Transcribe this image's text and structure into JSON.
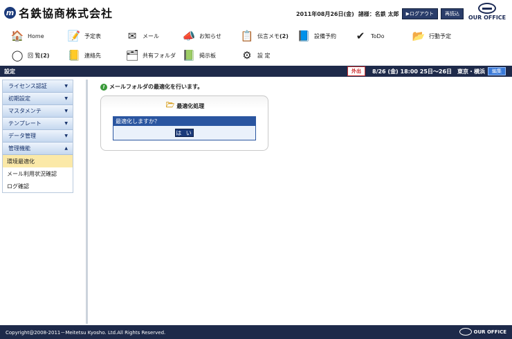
{
  "header": {
    "company": "名鉄協商株式会社",
    "logo_glyph": "m",
    "date": "2011年08月26日(金)",
    "user_label": "諸様：名鉄 太郎",
    "logout_label": "▶ログアウト",
    "reload_label": "再読込",
    "brand_text": "OUR OFFICE"
  },
  "nav": {
    "items": [
      {
        "label": "Home",
        "icon": "house-icon",
        "glyph": "🏠"
      },
      {
        "label": "予定表",
        "icon": "schedule-icon",
        "glyph": "📝"
      },
      {
        "label": "メール",
        "icon": "mail-icon",
        "glyph": "✉"
      },
      {
        "label": "お知らせ",
        "icon": "megaphone-icon",
        "glyph": "📣"
      },
      {
        "label": "伝言メモ",
        "count": "(2)",
        "icon": "memo-icon",
        "glyph": "📋"
      },
      {
        "label": "設備予約",
        "icon": "facility-icon",
        "glyph": "📘"
      },
      {
        "label": "ToDo",
        "icon": "todo-icon",
        "glyph": "✔"
      },
      {
        "label": "行動予定",
        "icon": "plan-icon",
        "glyph": "📂"
      },
      {
        "label": "回 覧",
        "count": "(2)",
        "icon": "circular-icon",
        "glyph": "◯"
      },
      {
        "label": "連絡先",
        "icon": "contacts-icon",
        "glyph": "📒"
      },
      {
        "label": "共有フォルダ",
        "icon": "shared-folder-icon",
        "glyph": "🗂"
      },
      {
        "label": "掲示板",
        "icon": "board-icon",
        "glyph": "📗"
      },
      {
        "label": "設 定",
        "icon": "settings-icon",
        "glyph": "⚙"
      }
    ]
  },
  "titlebar": {
    "title": "設定",
    "status_badge": "外出",
    "schedule": "8/26 (金) 18:00 25日～26日　東京・横浜",
    "edit_label": "編集"
  },
  "sidebar": {
    "sections": [
      {
        "label": "ライセンス認証",
        "arrow": "▼"
      },
      {
        "label": "初期設定",
        "arrow": "▼"
      },
      {
        "label": "マスタメンテ",
        "arrow": "▼"
      },
      {
        "label": "テンプレート",
        "arrow": "▼"
      },
      {
        "label": "データ管理",
        "arrow": "▼"
      },
      {
        "label": "管理機能",
        "arrow": "▲"
      }
    ],
    "subitems": [
      {
        "label": "環境最適化",
        "active": true
      },
      {
        "label": "メール利用状況確認",
        "active": false
      },
      {
        "label": "ログ確認",
        "active": false
      }
    ]
  },
  "main": {
    "message": "メールフォルダの最適化を行います。",
    "info_glyph": "!",
    "panel_title": "最適化処理",
    "confirm_question": "最適化しますか？",
    "yes_label": "は い"
  },
  "footer": {
    "copyright": "Copyright@2008-2011－Meitetsu Kyosho. Ltd.All Rights Reserved.",
    "brand_text": "OUR OFFICE"
  },
  "colors": {
    "navy": "#1e2a4a",
    "accent_blue": "#2a55a0",
    "active_item": "#fbe9a8"
  }
}
